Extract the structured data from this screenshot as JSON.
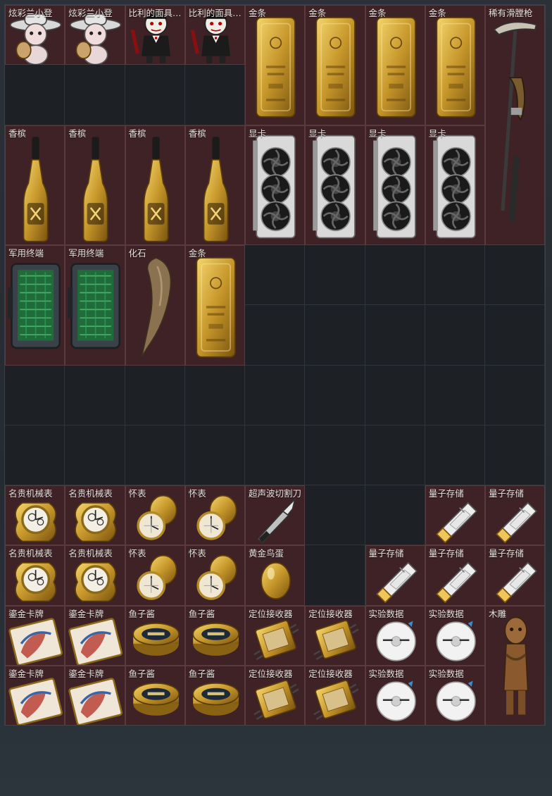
{
  "grid": {
    "cols": 9,
    "rows": 12
  },
  "colors": {
    "item_bg": "#3e2226",
    "item_border": "#5b3a3f",
    "empty_bg": "#1d2126",
    "text": "#e6e2dc"
  },
  "items": [
    {
      "id": "bear-figure",
      "name": "炫彩兰小登",
      "icon": "bear-figure-icon",
      "col": 0,
      "row": 0,
      "w": 1,
      "h": 1
    },
    {
      "id": "bear-figure",
      "name": "炫彩兰小登",
      "icon": "bear-figure-icon",
      "col": 1,
      "row": 0,
      "w": 1,
      "h": 1
    },
    {
      "id": "billy-puppet",
      "name": "比利的面具人偶",
      "icon": "puppet-figure-icon",
      "col": 2,
      "row": 0,
      "w": 1,
      "h": 1
    },
    {
      "id": "billy-puppet",
      "name": "比利的面具人偶",
      "icon": "puppet-figure-icon",
      "col": 3,
      "row": 0,
      "w": 1,
      "h": 1
    },
    {
      "id": "gold-bar",
      "name": "金条",
      "icon": "gold-bar-icon",
      "col": 4,
      "row": 0,
      "w": 1,
      "h": 2
    },
    {
      "id": "gold-bar",
      "name": "金条",
      "icon": "gold-bar-icon",
      "col": 5,
      "row": 0,
      "w": 1,
      "h": 2
    },
    {
      "id": "gold-bar",
      "name": "金条",
      "icon": "gold-bar-icon",
      "col": 6,
      "row": 0,
      "w": 1,
      "h": 2
    },
    {
      "id": "gold-bar",
      "name": "金条",
      "icon": "gold-bar-icon",
      "col": 7,
      "row": 0,
      "w": 1,
      "h": 2
    },
    {
      "id": "rare-rifle",
      "name": "稀有滑膛枪",
      "icon": "musket-icon",
      "col": 8,
      "row": 0,
      "w": 1,
      "h": 4
    },
    {
      "id": "champagne",
      "name": "香槟",
      "icon": "champagne-bottle-icon",
      "col": 0,
      "row": 2,
      "w": 1,
      "h": 2
    },
    {
      "id": "champagne",
      "name": "香槟",
      "icon": "champagne-bottle-icon",
      "col": 1,
      "row": 2,
      "w": 1,
      "h": 2
    },
    {
      "id": "champagne",
      "name": "香槟",
      "icon": "champagne-bottle-icon",
      "col": 2,
      "row": 2,
      "w": 1,
      "h": 2
    },
    {
      "id": "champagne",
      "name": "香槟",
      "icon": "champagne-bottle-icon",
      "col": 3,
      "row": 2,
      "w": 1,
      "h": 2
    },
    {
      "id": "gpu",
      "name": "显卡",
      "icon": "graphics-card-icon",
      "col": 4,
      "row": 2,
      "w": 1,
      "h": 2
    },
    {
      "id": "gpu",
      "name": "显卡",
      "icon": "graphics-card-icon",
      "col": 5,
      "row": 2,
      "w": 1,
      "h": 2
    },
    {
      "id": "gpu",
      "name": "显卡",
      "icon": "graphics-card-icon",
      "col": 6,
      "row": 2,
      "w": 1,
      "h": 2
    },
    {
      "id": "gpu",
      "name": "显卡",
      "icon": "graphics-card-icon",
      "col": 7,
      "row": 2,
      "w": 1,
      "h": 2
    },
    {
      "id": "military-terminal",
      "name": "军用终端",
      "icon": "terminal-device-icon",
      "col": 0,
      "row": 4,
      "w": 1,
      "h": 2
    },
    {
      "id": "military-terminal",
      "name": "军用终端",
      "icon": "terminal-device-icon",
      "col": 1,
      "row": 4,
      "w": 1,
      "h": 2
    },
    {
      "id": "fossil",
      "name": "化石",
      "icon": "fossil-claw-icon",
      "col": 2,
      "row": 4,
      "w": 1,
      "h": 2
    },
    {
      "id": "gold-bar",
      "name": "金条",
      "icon": "gold-bar-icon",
      "col": 3,
      "row": 4,
      "w": 1,
      "h": 2
    },
    {
      "id": "luxury-watch",
      "name": "名贵机械表",
      "icon": "wristwatch-icon",
      "col": 0,
      "row": 8,
      "w": 1,
      "h": 1
    },
    {
      "id": "luxury-watch",
      "name": "名贵机械表",
      "icon": "wristwatch-icon",
      "col": 1,
      "row": 8,
      "w": 1,
      "h": 1
    },
    {
      "id": "pocket-watch",
      "name": "怀表",
      "icon": "pocket-watch-icon",
      "col": 2,
      "row": 8,
      "w": 1,
      "h": 1
    },
    {
      "id": "pocket-watch",
      "name": "怀表",
      "icon": "pocket-watch-icon",
      "col": 3,
      "row": 8,
      "w": 1,
      "h": 1
    },
    {
      "id": "ultrasonic-cutter",
      "name": "超声波切割刀",
      "icon": "scalpel-icon",
      "col": 4,
      "row": 8,
      "w": 1,
      "h": 1
    },
    {
      "id": "quantum-storage",
      "name": "量子存储",
      "icon": "usb-drive-icon",
      "col": 7,
      "row": 8,
      "w": 1,
      "h": 1
    },
    {
      "id": "quantum-storage",
      "name": "量子存储",
      "icon": "usb-drive-icon",
      "col": 8,
      "row": 8,
      "w": 1,
      "h": 1
    },
    {
      "id": "luxury-watch",
      "name": "名贵机械表",
      "icon": "wristwatch-icon",
      "col": 0,
      "row": 9,
      "w": 1,
      "h": 1
    },
    {
      "id": "luxury-watch",
      "name": "名贵机械表",
      "icon": "wristwatch-icon",
      "col": 1,
      "row": 9,
      "w": 1,
      "h": 1
    },
    {
      "id": "pocket-watch",
      "name": "怀表",
      "icon": "pocket-watch-icon",
      "col": 2,
      "row": 9,
      "w": 1,
      "h": 1
    },
    {
      "id": "pocket-watch",
      "name": "怀表",
      "icon": "pocket-watch-icon",
      "col": 3,
      "row": 9,
      "w": 1,
      "h": 1
    },
    {
      "id": "golden-egg",
      "name": "黄金鸟蛋",
      "icon": "golden-egg-icon",
      "col": 4,
      "row": 9,
      "w": 1,
      "h": 1
    },
    {
      "id": "quantum-storage",
      "name": "量子存储",
      "icon": "usb-drive-icon",
      "col": 6,
      "row": 9,
      "w": 1,
      "h": 1
    },
    {
      "id": "quantum-storage",
      "name": "量子存储",
      "icon": "usb-drive-icon",
      "col": 7,
      "row": 9,
      "w": 1,
      "h": 1
    },
    {
      "id": "quantum-storage",
      "name": "量子存储",
      "icon": "usb-drive-icon",
      "col": 8,
      "row": 9,
      "w": 1,
      "h": 1
    },
    {
      "id": "gilded-card",
      "name": "鎏金卡牌",
      "icon": "gilded-card-icon",
      "col": 0,
      "row": 10,
      "w": 1,
      "h": 1
    },
    {
      "id": "gilded-card",
      "name": "鎏金卡牌",
      "icon": "gilded-card-icon",
      "col": 1,
      "row": 10,
      "w": 1,
      "h": 1
    },
    {
      "id": "caviar",
      "name": "鱼子酱",
      "icon": "caviar-tin-icon",
      "col": 2,
      "row": 10,
      "w": 1,
      "h": 1
    },
    {
      "id": "caviar",
      "name": "鱼子酱",
      "icon": "caviar-tin-icon",
      "col": 3,
      "row": 10,
      "w": 1,
      "h": 1
    },
    {
      "id": "gps-receiver",
      "name": "定位接收器",
      "icon": "receiver-module-icon",
      "col": 4,
      "row": 10,
      "w": 1,
      "h": 1
    },
    {
      "id": "gps-receiver",
      "name": "定位接收器",
      "icon": "receiver-module-icon",
      "col": 5,
      "row": 10,
      "w": 1,
      "h": 1
    },
    {
      "id": "experiment-data",
      "name": "实验数据",
      "icon": "data-disc-icon",
      "col": 6,
      "row": 10,
      "w": 1,
      "h": 1
    },
    {
      "id": "experiment-data",
      "name": "实验数据",
      "icon": "data-disc-icon",
      "col": 7,
      "row": 10,
      "w": 1,
      "h": 1
    },
    {
      "id": "wood-carving",
      "name": "木雕",
      "icon": "wood-statue-icon",
      "col": 8,
      "row": 10,
      "w": 1,
      "h": 2
    },
    {
      "id": "gilded-card",
      "name": "鎏金卡牌",
      "icon": "gilded-card-icon",
      "col": 0,
      "row": 11,
      "w": 1,
      "h": 1
    },
    {
      "id": "gilded-card",
      "name": "鎏金卡牌",
      "icon": "gilded-card-icon",
      "col": 1,
      "row": 11,
      "w": 1,
      "h": 1
    },
    {
      "id": "caviar",
      "name": "鱼子酱",
      "icon": "caviar-tin-icon",
      "col": 2,
      "row": 11,
      "w": 1,
      "h": 1
    },
    {
      "id": "caviar",
      "name": "鱼子酱",
      "icon": "caviar-tin-icon",
      "col": 3,
      "row": 11,
      "w": 1,
      "h": 1
    },
    {
      "id": "gps-receiver",
      "name": "定位接收器",
      "icon": "receiver-module-icon",
      "col": 4,
      "row": 11,
      "w": 1,
      "h": 1
    },
    {
      "id": "gps-receiver",
      "name": "定位接收器",
      "icon": "receiver-module-icon",
      "col": 5,
      "row": 11,
      "w": 1,
      "h": 1
    },
    {
      "id": "experiment-data",
      "name": "实验数据",
      "icon": "data-disc-icon",
      "col": 6,
      "row": 11,
      "w": 1,
      "h": 1
    },
    {
      "id": "experiment-data",
      "name": "实验数据",
      "icon": "data-disc-icon",
      "col": 7,
      "row": 11,
      "w": 1,
      "h": 1
    }
  ]
}
